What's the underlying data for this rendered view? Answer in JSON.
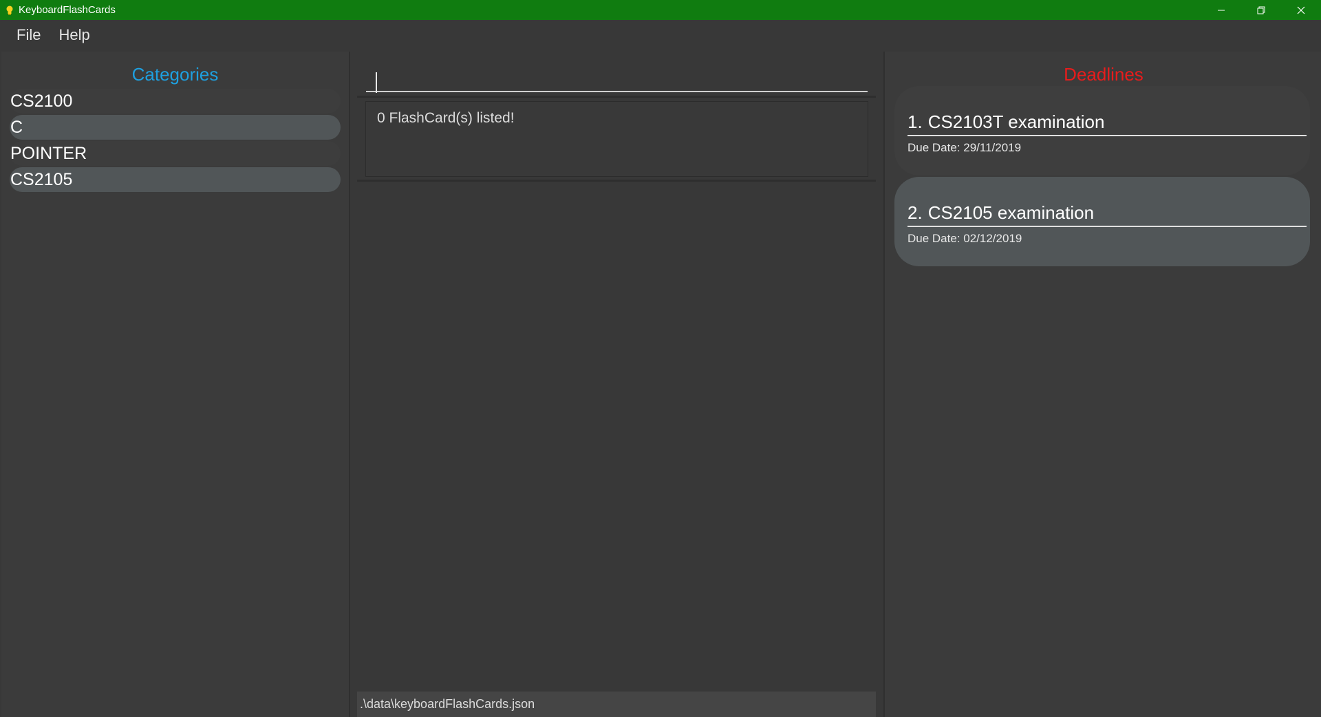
{
  "window": {
    "title": "KeyboardFlashCards",
    "accent_color": "#107c10",
    "icons": [
      "lightbulb-icon",
      "minimize-icon",
      "restore-icon",
      "close-icon"
    ]
  },
  "menu": {
    "file": "File",
    "help": "Help"
  },
  "categories": {
    "title": "Categories",
    "title_color": "#1ea0e0",
    "items": [
      "CS2100",
      "C",
      "POINTER",
      "CS2105"
    ]
  },
  "command": {
    "value": ""
  },
  "result": {
    "message": "0  FlashCard(s) listed!"
  },
  "status": {
    "path": ".\\data\\keyboardFlashCards.json"
  },
  "deadlines": {
    "title": "Deadlines",
    "title_color": "#e81c1c",
    "items": [
      {
        "index": "1.",
        "task": "CS2103T examination",
        "due": "Due Date: 29/11/2019"
      },
      {
        "index": "2.",
        "task": "CS2105 examination",
        "due": "Due Date: 02/12/2019"
      }
    ]
  }
}
